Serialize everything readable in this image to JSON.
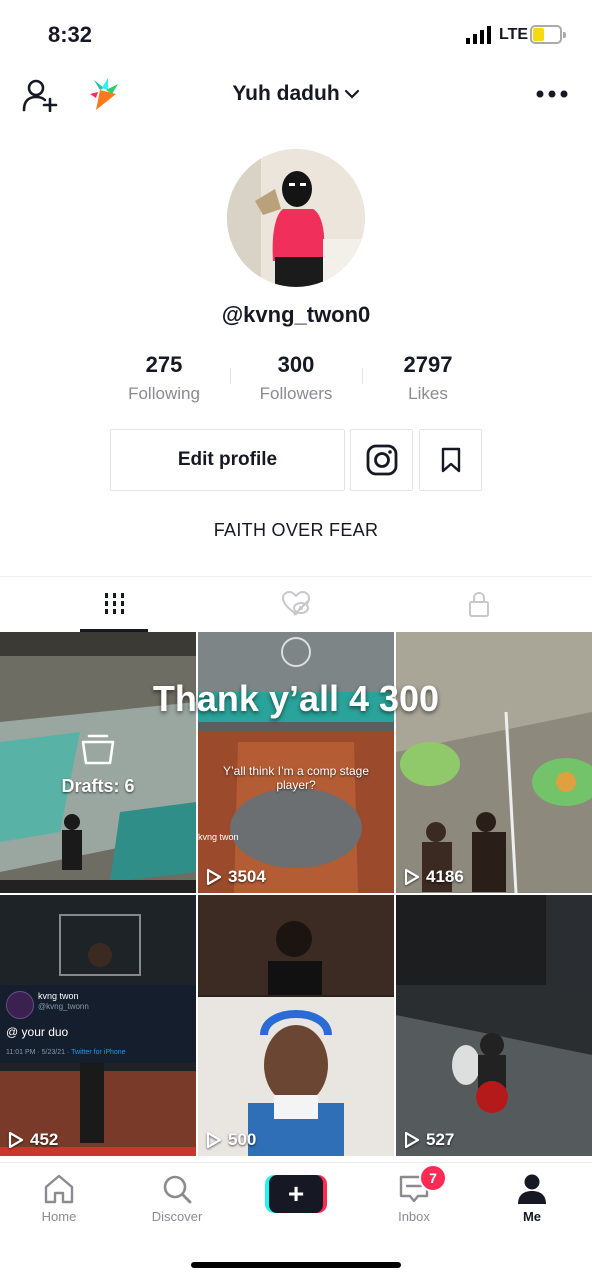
{
  "status_bar": {
    "time": "8:32",
    "network": "LTE"
  },
  "header": {
    "username": "Yuh daduh"
  },
  "profile": {
    "handle": "@kvng_twon0",
    "bio": "FAITH OVER FEAR",
    "stats": [
      {
        "value": "275",
        "label": "Following"
      },
      {
        "value": "300",
        "label": "Followers"
      },
      {
        "value": "2797",
        "label": "Likes"
      }
    ],
    "edit_label": "Edit profile"
  },
  "grid": {
    "drafts_label": "Drafts: 6",
    "overlay_title": "Thank y’all 4 300",
    "tiles": [
      {
        "views": "3504",
        "caption": "Y’all think I’m a comp stage player?",
        "watermark": "kvng twon"
      },
      {
        "views": "4186"
      },
      {
        "views": "452",
        "tweet": {
          "name": "kvng twon",
          "handle": "@kvng_twonn",
          "text": "@ your duo",
          "meta": "11:01 PM · 5/23/21 · ",
          "client": "Twitter for iPhone"
        }
      },
      {
        "views": "500"
      },
      {
        "views": "527"
      }
    ]
  },
  "nav": {
    "items": [
      {
        "label": "Home",
        "icon": "home-icon"
      },
      {
        "label": "Discover",
        "icon": "search-icon"
      },
      {
        "label": "Inbox",
        "icon": "inbox-icon",
        "badge": "7"
      },
      {
        "label": "Me",
        "icon": "profile-icon"
      }
    ]
  },
  "colors": {
    "accent_red": "#fe2c55",
    "accent_cyan": "#25f4ee",
    "text": "#161823",
    "muted": "#8a8b91"
  }
}
